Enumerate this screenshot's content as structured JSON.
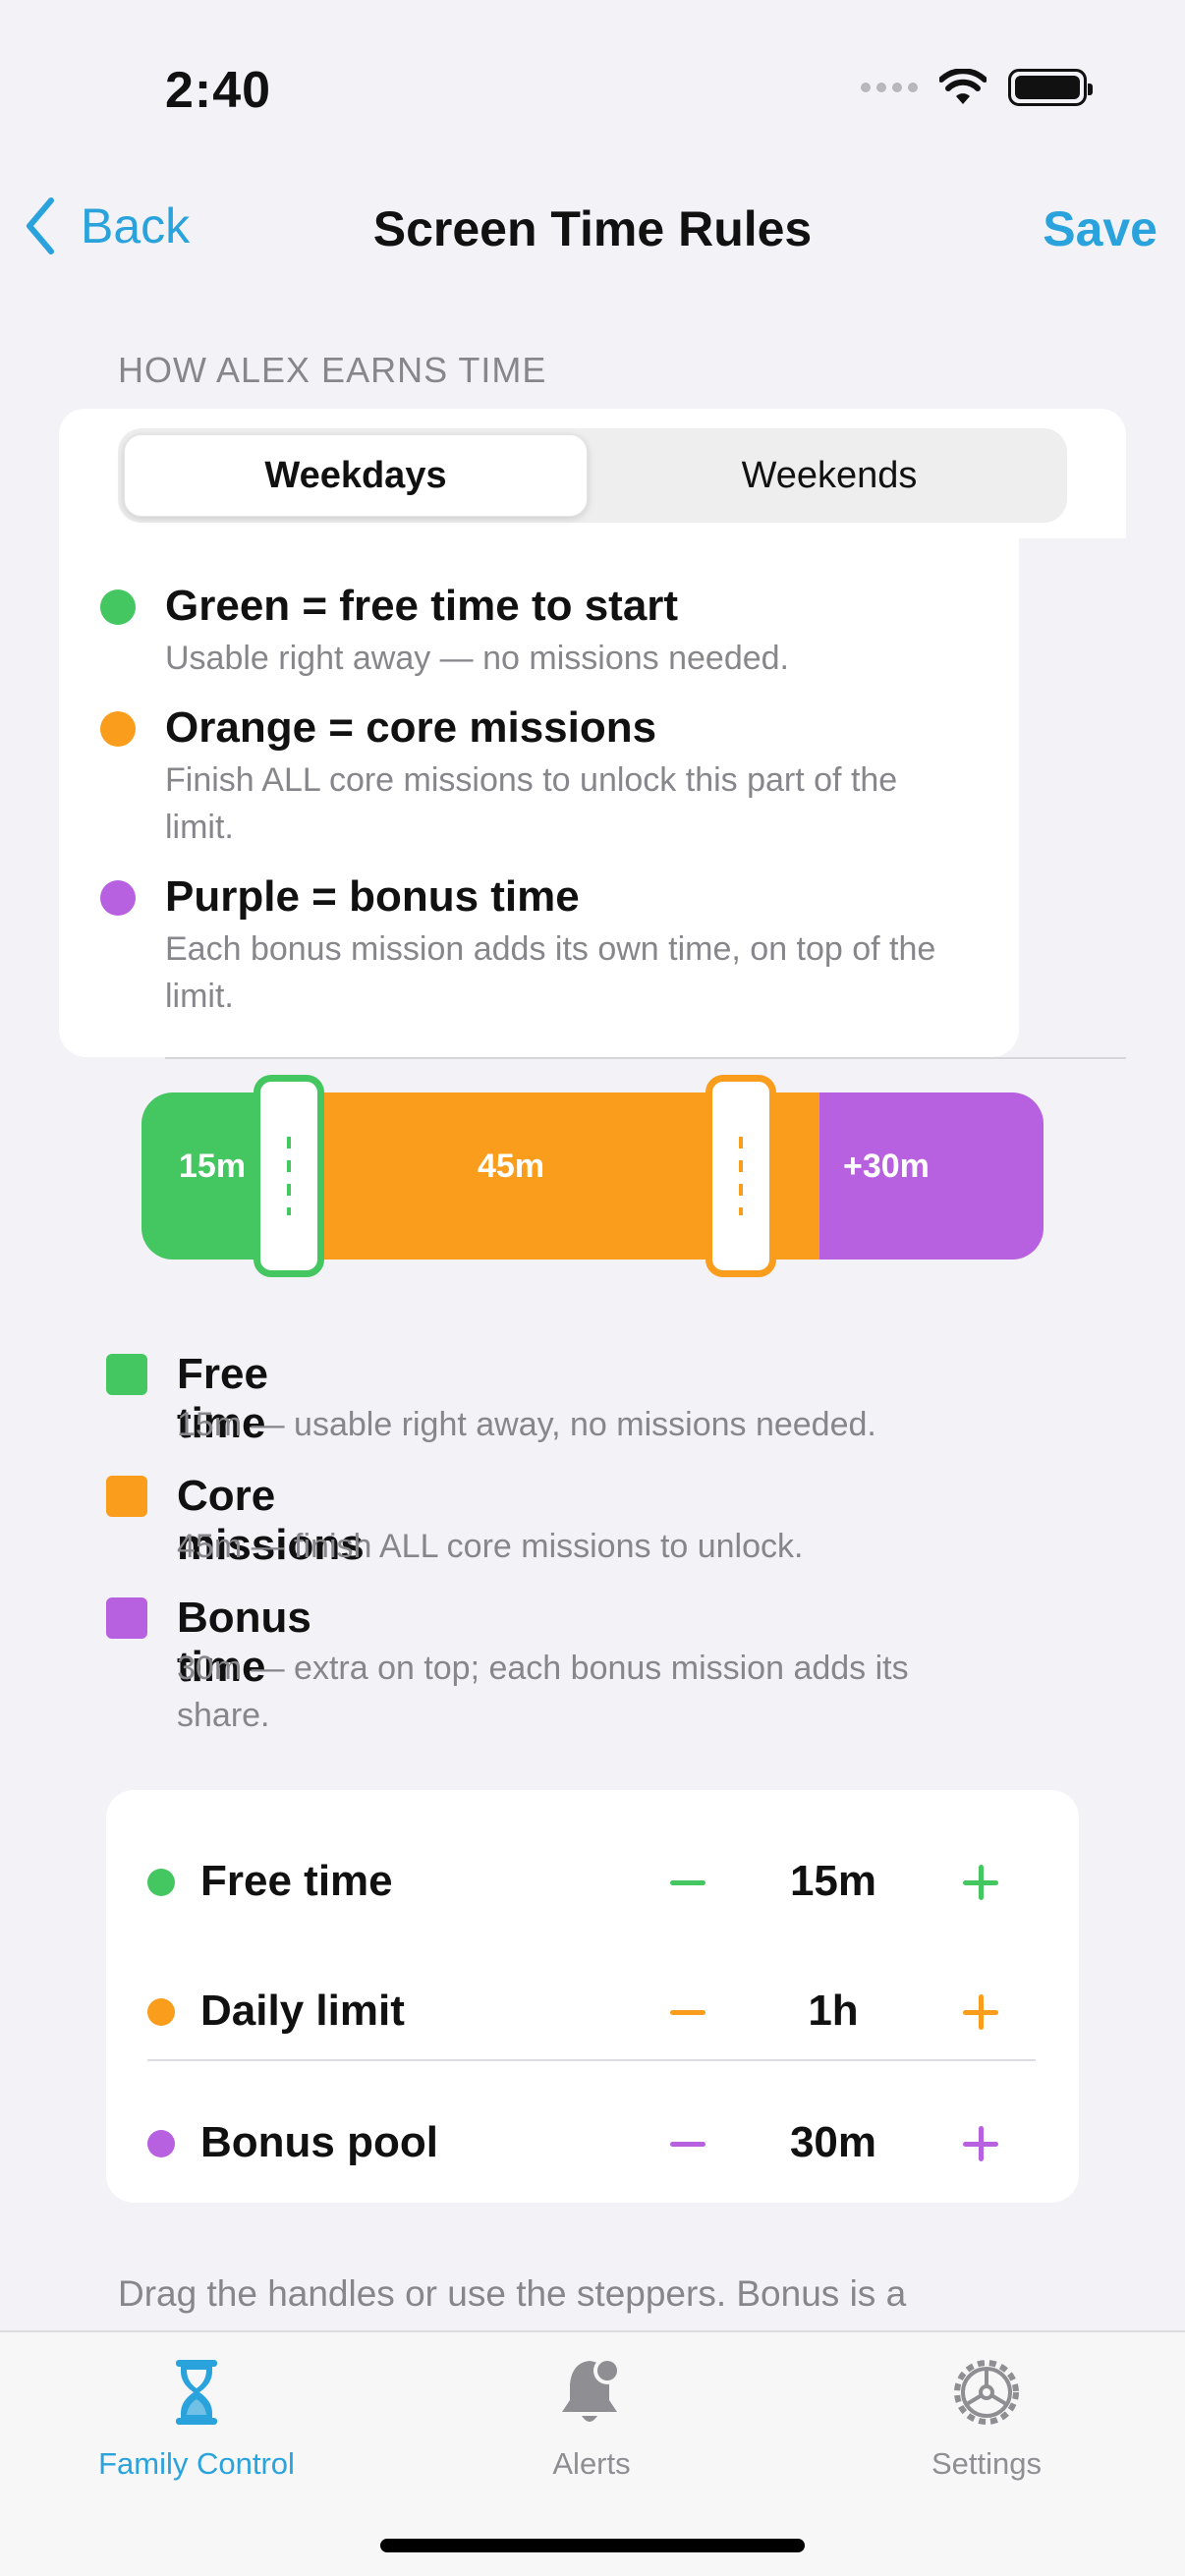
{
  "status": {
    "time": "2:40"
  },
  "nav": {
    "back_label": "Back",
    "title": "Screen Time Rules",
    "save_label": "Save"
  },
  "section_header": "HOW ALEX EARNS TIME",
  "segments": {
    "weekdays": "Weekdays",
    "weekends": "Weekends",
    "selected": "Weekdays"
  },
  "info": [
    {
      "title": "Green = free time to start",
      "desc": "Usable right away — no missions needed.",
      "color": "#44c660"
    },
    {
      "title": "Orange = core missions",
      "desc": "Finish ALL core missions to unlock this part of the limit.",
      "color": "#fa9d1c"
    },
    {
      "title": "Purple = bonus time",
      "desc": "Each bonus mission adds its own time, on top of the limit.",
      "color": "#b760e0"
    }
  ],
  "bar": {
    "free": "15m",
    "core": "45m",
    "bonus": "+30m"
  },
  "legend": [
    {
      "title": "Free time",
      "desc": "15m — usable right away, no missions needed.",
      "color": "#44c660"
    },
    {
      "title": "Core missions",
      "desc": "45m — finish ALL core missions to unlock.",
      "color": "#fa9d1c"
    },
    {
      "title": "Bonus time",
      "desc": "30m — extra on top; each bonus mission adds its share.",
      "color": "#b760e0"
    }
  ],
  "steppers": [
    {
      "label": "Free time",
      "value": "15m",
      "color": "#44c660"
    },
    {
      "label": "Daily limit",
      "value": "1h",
      "color": "#fa9d1c"
    },
    {
      "label": "Bonus pool",
      "value": "30m",
      "color": "#b760e0"
    }
  ],
  "footer_note": "Drag the handles or use the steppers. Bonus is a",
  "tabs": [
    {
      "label": "Family Control",
      "icon": "hourglass-icon",
      "active": true
    },
    {
      "label": "Alerts",
      "icon": "bell-icon",
      "active": false
    },
    {
      "label": "Settings",
      "icon": "gear-icon",
      "active": false
    }
  ],
  "colors": {
    "accent": "#2aa3dc",
    "green": "#44c660",
    "orange": "#fa9d1c",
    "purple": "#b760e0"
  }
}
